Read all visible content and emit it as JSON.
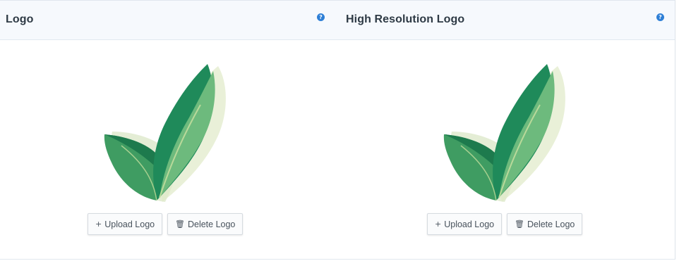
{
  "panels": [
    {
      "title": "Logo",
      "help_icon": "question-circle-icon",
      "help_glyph": "?",
      "upload_label": "Upload Logo",
      "upload_icon": "plus-icon",
      "upload_glyph": "+",
      "delete_label": "Delete Logo",
      "delete_icon": "trash-icon",
      "delete_glyph": "🗑"
    },
    {
      "title": "High Resolution Logo",
      "help_icon": "question-circle-icon",
      "help_glyph": "?",
      "upload_label": "Upload Logo",
      "upload_icon": "plus-icon",
      "upload_glyph": "+",
      "delete_label": "Delete Logo",
      "delete_icon": "trash-icon",
      "delete_glyph": "🗑"
    }
  ],
  "colors": {
    "leaf_dark": "#1f8a5a",
    "leaf_mid": "#43a86b",
    "leaf_light": "#7cc17c",
    "accent_help": "#2e7fd6"
  }
}
